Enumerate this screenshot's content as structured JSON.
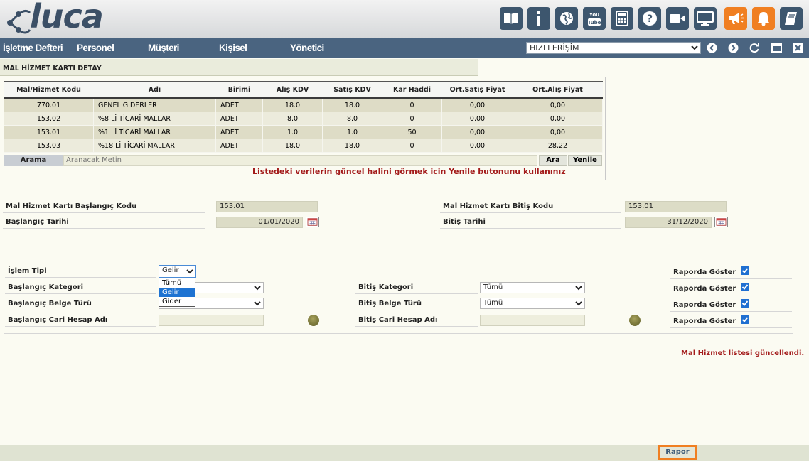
{
  "header": {
    "logo_text": "luca",
    "toolbar_icons": [
      "book-icon",
      "info-icon",
      "globe-icon",
      "youtube-icon",
      "calculator-icon",
      "help-icon",
      "video-icon",
      "monitor-icon",
      "megaphone-icon",
      "bell-icon",
      "notebook-icon"
    ]
  },
  "menu": {
    "items": [
      "İşletme Defteri",
      "Personel",
      "Müşteri",
      "Kişisel",
      "Yönetici"
    ],
    "quick_access": "HIZLI ERİŞİM"
  },
  "panel": {
    "title": "MAL HİZMET KARTI DETAY"
  },
  "table": {
    "columns": [
      "Mal/Hizmet Kodu",
      "Adı",
      "Birimi",
      "Alış KDV",
      "Satış KDV",
      "Kar Haddi",
      "Ort.Satış Fiyat",
      "Ort.Alış Fiyat"
    ],
    "rows": [
      [
        "770.01",
        "GENEL GİDERLER",
        "ADET",
        "18.0",
        "18.0",
        "0",
        "0,00",
        "0,00"
      ],
      [
        "153.02",
        "%8 Lİ TİCARİ MALLAR",
        "ADET",
        "8.0",
        "8.0",
        "0",
        "0,00",
        "0,00"
      ],
      [
        "153.01",
        "%1 Lİ TİCARİ MALLAR",
        "ADET",
        "1.0",
        "1.0",
        "50",
        "0,00",
        "0,00"
      ],
      [
        "153.03",
        "%18 Lİ TİCARİ MALLAR",
        "ADET",
        "18.0",
        "18.0",
        "0",
        "0,00",
        "28,22"
      ]
    ]
  },
  "search": {
    "label": "Arama",
    "placeholder": "Aranacak Metin",
    "ara": "Ara",
    "yenile": "Yenile"
  },
  "notice": "Listedeki verilerin güncel halini görmek için Yenile butonunu kullanınız",
  "form": {
    "start_code_label": "Mal Hizmet Kartı Başlangıç Kodu",
    "start_code": "153.01",
    "end_code_label": "Mal Hizmet Kartı Bitiş Kodu",
    "end_code": "153.01",
    "start_date_label": "Başlangıç Tarihi",
    "start_date": "01/01/2020",
    "end_date_label": "Bitiş Tarihi",
    "end_date": "31/12/2020",
    "islem_tipi_label": "İşlem Tipi",
    "islem_tipi_value": "Gelir",
    "islem_tipi_options": [
      "Tümü",
      "Gelir",
      "Gider"
    ],
    "start_category_label": "Başlangıç Kategori",
    "end_category_label": "Bitiş Kategori",
    "end_category_value": "Tümü",
    "start_doc_label": "Başlangıç Belge Türü",
    "end_doc_label": "Bitiş Belge Türü",
    "end_doc_value": "Tümü",
    "start_cari_label": "Başlangıç Cari Hesap Adı",
    "end_cari_label": "Bitiş Cari Hesap Adı",
    "show_in_report": "Raporda Göster"
  },
  "status_message": "Mal Hizmet listesi güncellendi.",
  "footer": {
    "rapor": "Rapor"
  },
  "colors": {
    "header_bar": "#4a6480",
    "icon_bg": "#3d566e",
    "accent": "#f07f22",
    "notice_red": "#a31b1b",
    "checkbox": "#1f6fd1"
  }
}
